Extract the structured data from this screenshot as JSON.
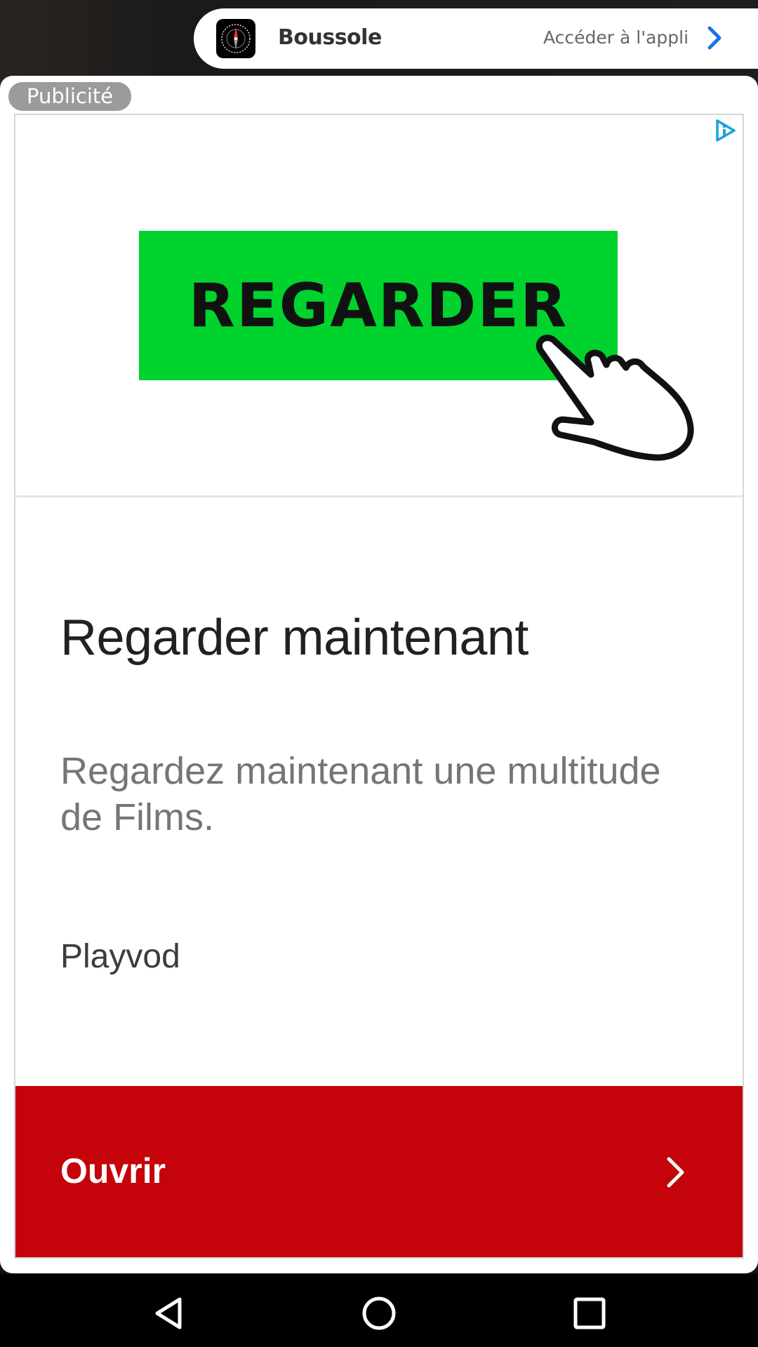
{
  "app_banner": {
    "name": "Boussole",
    "cta": "Accéder à l'appli"
  },
  "ad": {
    "label": "Publicité",
    "hero_button": "REGARDER",
    "headline": "Regarder maintenant",
    "body": "Regardez maintenant une multitude de Films.",
    "advertiser": "Playvod",
    "cta": "Ouvrir"
  },
  "colors": {
    "hero_green": "#00d32d",
    "cta_red": "#c4040a",
    "link_blue": "#1a73e8"
  },
  "icons": {
    "app_icon": "compass-icon",
    "banner_chevron": "chevron-right-icon",
    "adchoices": "adchoices-icon",
    "hand": "pointing-hand-icon",
    "cta_chevron": "chevron-right-icon",
    "nav_back": "back-icon",
    "nav_home": "home-icon",
    "nav_recent": "recents-icon"
  }
}
